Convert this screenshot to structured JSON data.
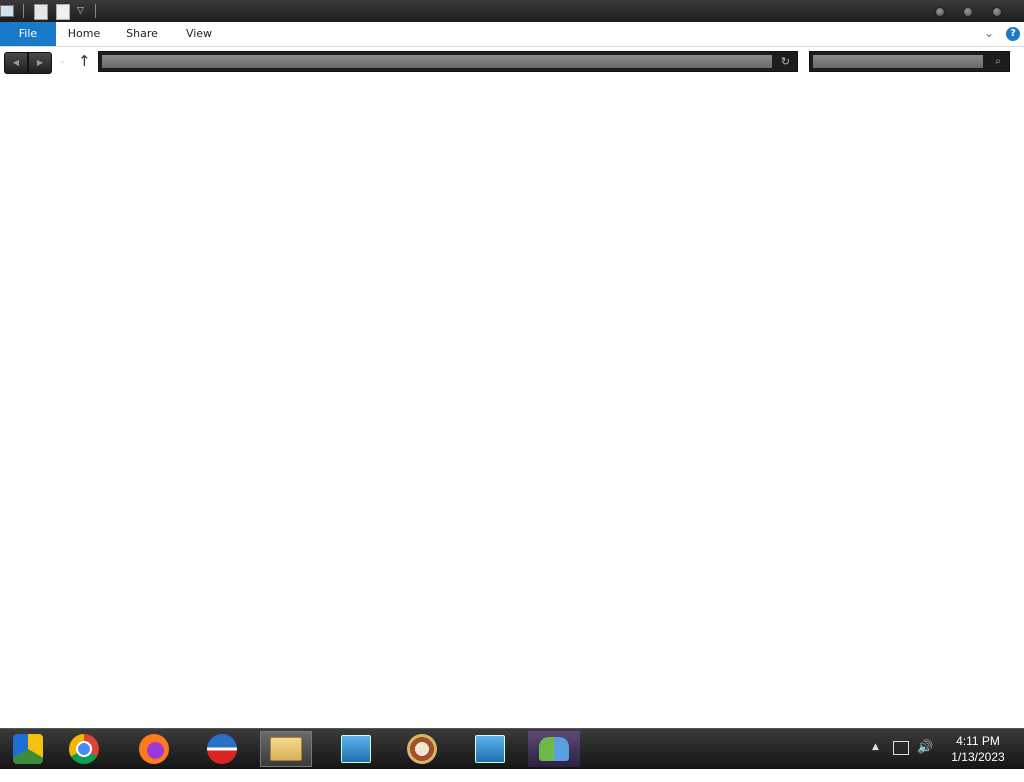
{
  "ribbon": {
    "tabs": [
      "File",
      "Home",
      "Share",
      "View"
    ],
    "help_glyph": "?"
  },
  "navigation": {
    "address_value": "",
    "search_placeholder": ""
  },
  "taskbar": {
    "apps": [
      {
        "name": "Google Chrome Canary",
        "icon": "chrome-canary-icon"
      },
      {
        "name": "Google Chrome",
        "icon": "chrome-icon"
      },
      {
        "name": "Firefox",
        "icon": "firefox-icon"
      },
      {
        "name": "Web browser",
        "icon": "browser-icon"
      },
      {
        "name": "File Explorer",
        "icon": "file-explorer-icon"
      },
      {
        "name": "Network setup",
        "icon": "network-setup-icon"
      },
      {
        "name": "Media app",
        "icon": "media-icon"
      },
      {
        "name": "Network setup 2",
        "icon": "network-setup-icon"
      },
      {
        "name": "People app",
        "icon": "people-icon"
      }
    ],
    "clock_time": "4:11 PM",
    "clock_date": "1/13/2023"
  },
  "colors": {
    "accent": "#1979ca",
    "titlebar": "#2a2a2a",
    "taskbar": "#1f1f1f"
  }
}
